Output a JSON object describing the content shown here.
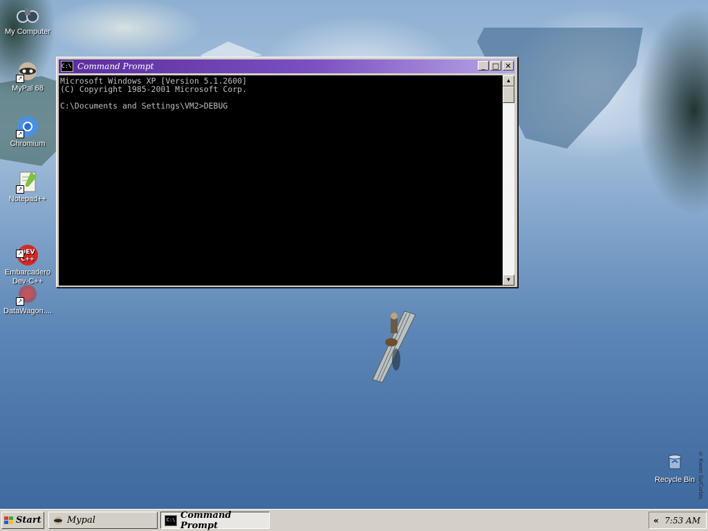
{
  "desktop": {
    "icons": [
      {
        "label": "My Computer",
        "icon": "binoculars-icon"
      },
      {
        "label": "MyPal 68",
        "icon": "raccoon-browser-icon"
      },
      {
        "label": "Chromium",
        "icon": "chromium-icon"
      },
      {
        "label": "Notepad++",
        "icon": "notepadpp-icon"
      },
      {
        "label": "Embarcadero\nDev-C++",
        "icon": "devcpp-icon"
      },
      {
        "label": "DataWagon....",
        "icon": "datawagon-icon"
      },
      {
        "label": "Recycle Bin",
        "icon": "recycle-bin-icon"
      }
    ],
    "watermark": "© Karen Su/Corbis"
  },
  "window": {
    "title": "Command Prompt",
    "buttons": {
      "minimize": "_",
      "maximize": "□",
      "close": "✕"
    },
    "console_lines": [
      "Microsoft Windows XP [Version 5.1.2600]",
      "(C) Copyright 1985-2001 Microsoft Corp.",
      "",
      "C:\\Documents and Settings\\VM2>DEBUG"
    ]
  },
  "taskbar": {
    "start_label": "Start",
    "tasks": [
      {
        "label": "Mypal",
        "active": false
      },
      {
        "label": "Command Prompt",
        "active": true
      }
    ],
    "tray_chevron": "«",
    "clock": "7:53 AM"
  },
  "colors": {
    "titlebar_start": "#5a2d9b",
    "titlebar_end": "#b8a6e6",
    "console_bg": "#000000",
    "console_text": "#c0c0c0",
    "taskbar": "#d4d0c8"
  }
}
